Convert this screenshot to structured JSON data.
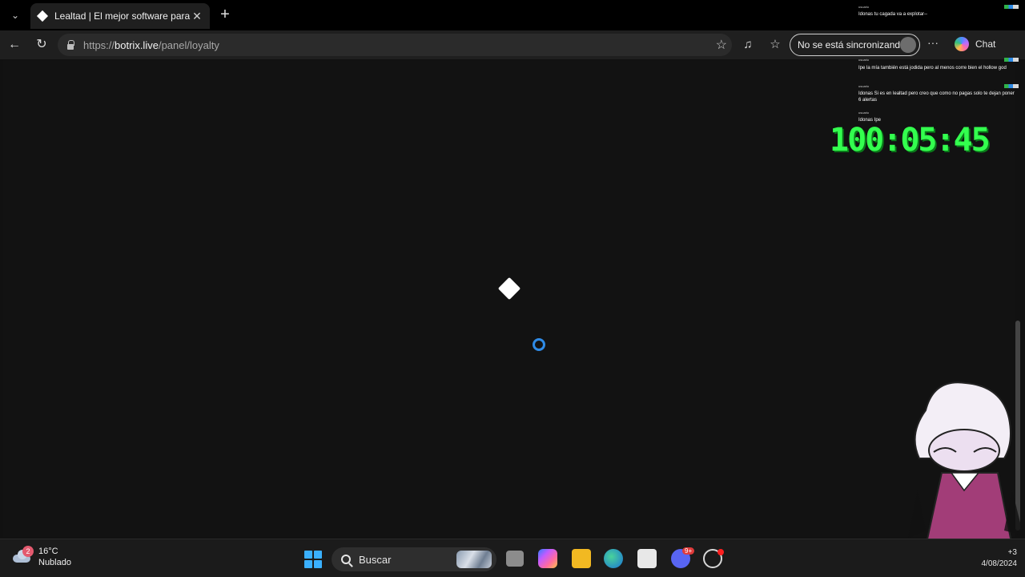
{
  "browser": {
    "tab": {
      "title": "Lealtad | El mejor software para po",
      "close": "✕"
    },
    "new_tab": "+",
    "url_prefix": "https://",
    "url_host": "botrix.live",
    "url_path": "/panel/loyalty",
    "sync_label": "No se está sincronizando",
    "chat_label": "Chat",
    "more": "···"
  },
  "overlay": {
    "chat": [
      {
        "user": "usuario",
        "text": "Idonas tu cagada va a explotar--"
      },
      {
        "user": "usuario",
        "text": "Ipe la mía también está jodida pero al menos corre bien el hollow god"
      },
      {
        "user": "usuario",
        "text": "Idonas Si es en lealtad pero creo que como no pagas solo te dejan poner 6 alertas"
      },
      {
        "user": "usuario",
        "text": "Idonas Ipe"
      }
    ],
    "timer": "100:05:45"
  },
  "taskbar": {
    "weather_temp": "16°C",
    "weather_desc": "Nublado",
    "weather_badge": "2",
    "search_placeholder": "Buscar",
    "tray_count": "+3",
    "tray_date": "4/08/2024",
    "discord_badge": "9+"
  }
}
